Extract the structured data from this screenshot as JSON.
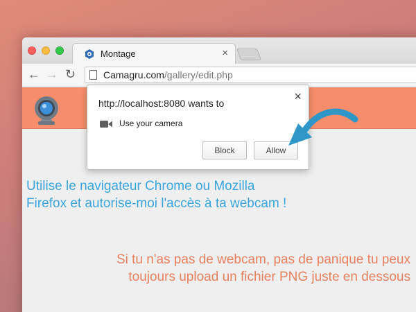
{
  "tab": {
    "title": "Montage",
    "close_glyph": "×",
    "favicon": "hexagon-camera-icon"
  },
  "toolbar": {
    "back_glyph": "←",
    "forward_glyph": "→",
    "reload_glyph": "↻",
    "url_host": "Camagru.com",
    "url_path": "/gallery/edit.php"
  },
  "popup": {
    "title": "http://localhost:8080 wants to",
    "close_glyph": "×",
    "permission": "Use your camera",
    "block_label": "Block",
    "allow_label": "Allow"
  },
  "page": {
    "intro_line1": "Utilise le navigateur Chrome ou Mozilla",
    "intro_line2": "Firefox et autorise-moi l'accès à ta webcam !",
    "nowebcam_text": "Si tu n'as pas de webcam, pas de panique tu peux toujours upload un fichier PNG juste en dessous"
  },
  "colors": {
    "banner": "#f68e6c",
    "intro_text": "#3aa5de",
    "nowebcam_text": "#e7805f",
    "arrow": "#2e97c8"
  }
}
